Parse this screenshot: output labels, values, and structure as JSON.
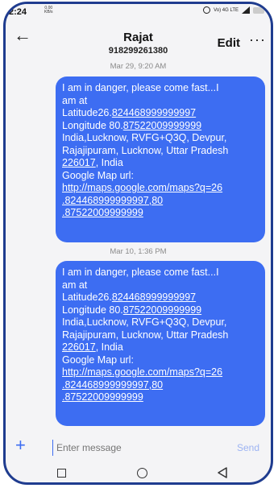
{
  "status": {
    "time": "2:24",
    "speed_value": "0.00",
    "speed_unit": "KB/s",
    "network": "Vo) 4G LTE"
  },
  "header": {
    "contact_name": "Rajat",
    "contact_number": "918299261380",
    "edit_label": "Edit",
    "more_label": "···"
  },
  "messages": [
    {
      "timestamp": "Mar 29, 9:20 AM",
      "lines": [
        {
          "text": "I am in danger, please come fast...I"
        },
        {
          "text": "am at"
        },
        {
          "pre": "Latitude26.",
          "link": "824468999999997"
        },
        {
          "pre": "Longitude 80.",
          "link": "87522009999999"
        },
        {
          "text": "India,Lucknow, RVFG+Q3Q, Devpur,"
        },
        {
          "text": "Rajajipuram, Lucknow, Uttar Pradesh"
        },
        {
          "link": "226017",
          "post": ", India"
        },
        {
          "text": "Google Map url:"
        },
        {
          "link": "http://maps.google.com/maps?q=26"
        },
        {
          "link": ".824468999999997,80"
        },
        {
          "link": ".87522009999999"
        }
      ]
    },
    {
      "timestamp": "Mar 10, 1:36 PM",
      "lines": [
        {
          "text": "I am in danger, please come fast...I"
        },
        {
          "text": "am at"
        },
        {
          "pre": "Latitude26.",
          "link": "824468999999997"
        },
        {
          "pre": "Longitude 80.",
          "link": "87522009999999"
        },
        {
          "text": "India,Lucknow, RVFG+Q3Q, Devpur,"
        },
        {
          "text": "Rajajipuram, Lucknow, Uttar Pradesh"
        },
        {
          "link": "226017",
          "post": ", India"
        },
        {
          "text": "Google Map url:"
        },
        {
          "link": "http://maps.google.com/maps?q=26"
        },
        {
          "link": ".824468999999997,80"
        },
        {
          "link": ".87522009999999"
        }
      ]
    }
  ],
  "composer": {
    "placeholder": "Enter message",
    "send_label": "Send",
    "add_label": "+"
  },
  "colors": {
    "bubble": "#3d6df2",
    "accent": "#3d6df2",
    "frame_border": "#1f3c8f"
  },
  "icons": {
    "back": "back-arrow-icon",
    "more": "more-icon",
    "add": "plus-icon",
    "nav": [
      "recents-icon",
      "home-icon",
      "back-triangle-icon"
    ]
  }
}
